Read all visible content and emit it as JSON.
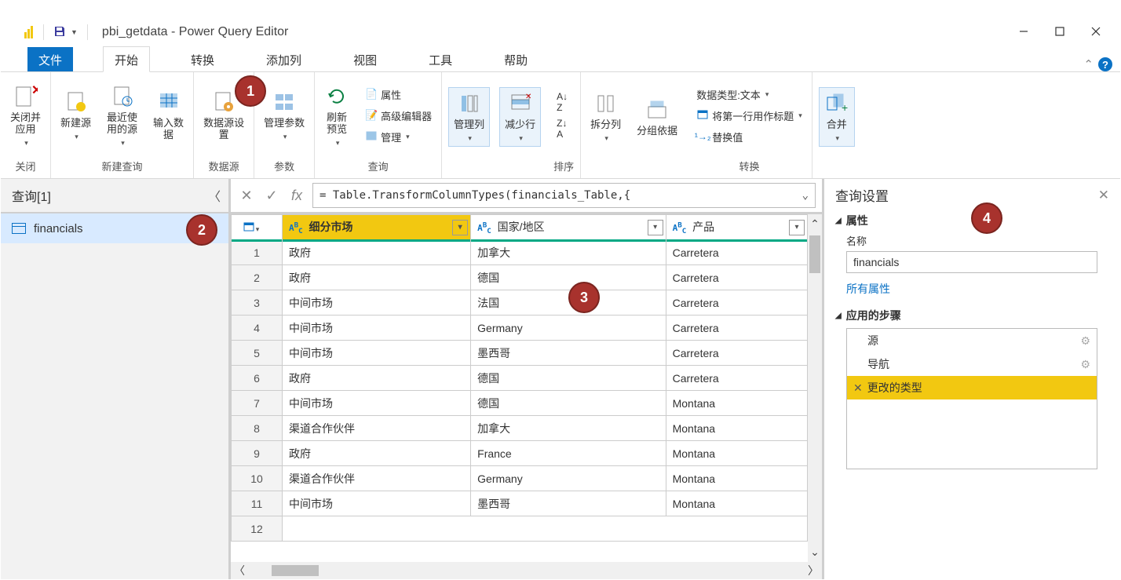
{
  "title": "pbi_getdata - Power Query Editor",
  "tabs": {
    "file": "文件",
    "home": "开始",
    "transform": "转换",
    "addcol": "添加列",
    "view": "视图",
    "tools": "工具",
    "help": "帮助"
  },
  "ribbon": {
    "close": {
      "btn": "关闭并\n应用",
      "group": "关闭"
    },
    "newq": {
      "newsrc": "新建源",
      "recent": "最近使\n用的源",
      "enter": "输入数\n据",
      "group": "新建查询"
    },
    "ds": {
      "btn": "数据源设\n置",
      "group": "数据源"
    },
    "params": {
      "btn": "管理参数",
      "group": "参数"
    },
    "query": {
      "refresh": "刷新\n预览",
      "props": "属性",
      "adv": "高级编辑器",
      "manage": "管理",
      "group": "查询"
    },
    "cols": {
      "manage": "管理列",
      "reduce": "减少行"
    },
    "sort": {
      "group": "排序"
    },
    "split": "拆分列",
    "groupby": "分组依据",
    "trans": {
      "dtype": "数据类型:文本",
      "firstrow": "将第一行用作标题",
      "replace": "替换值",
      "group": "转换"
    },
    "combine": "合并"
  },
  "queries": {
    "header": "查询[1]",
    "item": "financials"
  },
  "formula": "= Table.TransformColumnTypes(financials_Table,{",
  "columns": [
    {
      "name": "细分市场",
      "sel": true
    },
    {
      "name": "国家/地区",
      "sel": false
    },
    {
      "name": "产品",
      "sel": false
    }
  ],
  "rows": [
    [
      "政府",
      "加拿大",
      "Carretera"
    ],
    [
      "政府",
      "德国",
      "Carretera"
    ],
    [
      "中间市场",
      "法国",
      "Carretera"
    ],
    [
      "中间市场",
      "Germany",
      "Carretera"
    ],
    [
      "中间市场",
      "墨西哥",
      "Carretera"
    ],
    [
      "政府",
      "德国",
      "Carretera"
    ],
    [
      "中间市场",
      "德国",
      "Montana"
    ],
    [
      "渠道合作伙伴",
      "加拿大",
      "Montana"
    ],
    [
      "政府",
      "France",
      "Montana"
    ],
    [
      "渠道合作伙伴",
      "Germany",
      "Montana"
    ],
    [
      "中间市场",
      "墨西哥",
      "Montana"
    ]
  ],
  "settings": {
    "title": "查询设置",
    "propsHdr": "属性",
    "nameLbl": "名称",
    "name": "financials",
    "allprops": "所有属性",
    "stepsHdr": "应用的步骤",
    "steps": [
      {
        "t": "源",
        "gear": true
      },
      {
        "t": "导航",
        "gear": true
      },
      {
        "t": "更改的类型",
        "sel": true,
        "x": true
      }
    ]
  },
  "callouts": {
    "c1": "1",
    "c2": "2",
    "c3": "3",
    "c4": "4"
  }
}
